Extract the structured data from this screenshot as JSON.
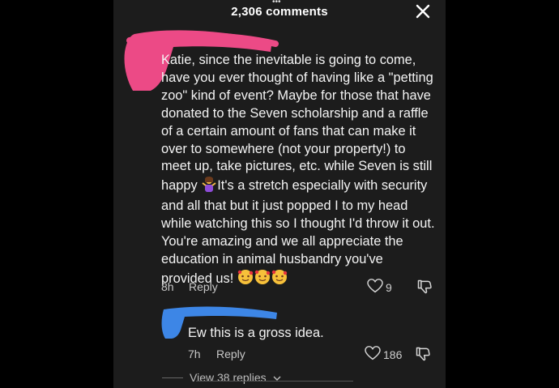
{
  "header": {
    "title": "2,306 comments"
  },
  "comment": {
    "text_before_emoji": "Katie, since the inevitable is going to come, have you ever thought of having like a \"petting zoo\" kind of event? Maybe for those that have donated to the Seven scholarship and a raffle of a certain amount of fans that can make it over to somewhere (not your property!) to meet up, take pictures, etc. while Seven is still happy ",
    "text_after_emoji": "It's a stretch especially with security and all that but it just popped I to my head while watching this so I thought I'd throw it out. You're amazing and we all appreciate the education in animal husbandry you've provided us! ",
    "time": "8h",
    "reply_label": "Reply",
    "like_count": "9",
    "avatar_redaction_color": "#ec4a86"
  },
  "reply": {
    "text": "Ew this is a gross idea.",
    "time": "7h",
    "reply_label": "Reply",
    "like_count": "186",
    "avatar_redaction_color": "#3d86e6"
  },
  "view_replies": {
    "label": "View 38 replies"
  },
  "icons": {
    "close": "close-icon",
    "heart": "heart-icon",
    "dislike": "thumbs-down-icon",
    "shrug_emoji": "person-shrugging-emoji",
    "hearts_face_emoji": "smiling-face-with-hearts-emoji"
  }
}
